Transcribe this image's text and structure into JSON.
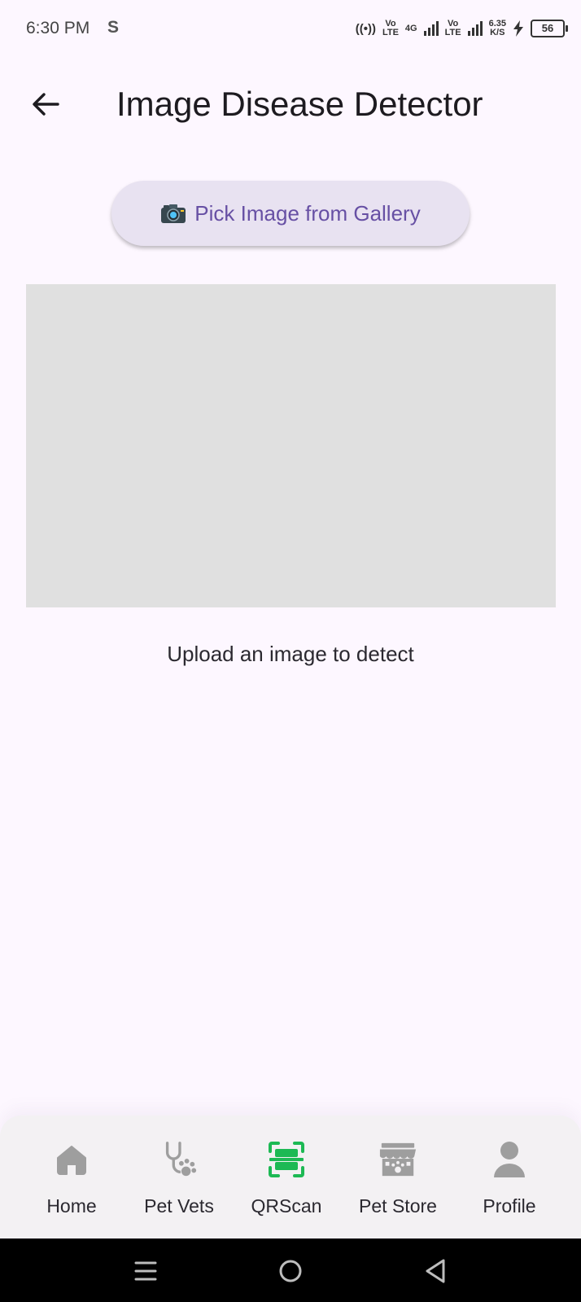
{
  "status_bar": {
    "time": "6:30 PM",
    "carrier_icon": "S",
    "vo_lte_1": [
      "Vo",
      "LTE"
    ],
    "net_type": "4G",
    "vo_lte_2": [
      "Vo",
      "LTE"
    ],
    "speed": [
      "6.35",
      "K/S"
    ],
    "battery": "56"
  },
  "app_bar": {
    "title": "Image Disease Detector",
    "back_icon": "arrow-left-icon"
  },
  "actions": {
    "pick_image_label": "Pick Image from Gallery",
    "pick_image_icon": "camera-icon"
  },
  "preview": {
    "hint": "Upload an image to detect"
  },
  "bottom_nav": {
    "active": "QRScan",
    "active_color": "#1db954",
    "inactive_color": "#9e9e9e",
    "items": [
      {
        "label": "Home",
        "icon": "home-icon"
      },
      {
        "label": "Pet Vets",
        "icon": "stethoscope-paw-icon"
      },
      {
        "label": "QRScan",
        "icon": "scan-icon"
      },
      {
        "label": "Pet Store",
        "icon": "store-icon"
      },
      {
        "label": "Profile",
        "icon": "person-icon"
      }
    ]
  },
  "system_nav": {
    "buttons": [
      "menu-icon",
      "home-circle-icon",
      "back-triangle-icon"
    ]
  }
}
